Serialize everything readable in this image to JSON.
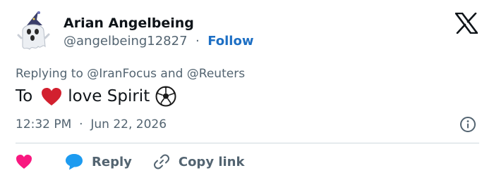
{
  "author": {
    "name": "Arian Angelbeing",
    "handle": "@angelbeing12827",
    "separator": "·",
    "follow_label": "Follow",
    "avatar_icon": "ghost-wizard-avatar"
  },
  "reply": {
    "prefix": "Replying to ",
    "user1": "@IranFocus",
    "conj": " and ",
    "user2": "@Reuters"
  },
  "tweet": {
    "text_before": "To",
    "text_after": "love Spirit"
  },
  "meta": {
    "time": "12:32 PM",
    "separator": "·",
    "date": "Jun 22, 2026"
  },
  "actions": {
    "reply_label": "Reply",
    "copy_label": "Copy link"
  },
  "colors": {
    "follow": "#1d6fc4",
    "heart_like": "#f91880",
    "heart_emoji": "#d2202f",
    "reply_bubble": "#1d9bf0",
    "muted": "#536471"
  }
}
